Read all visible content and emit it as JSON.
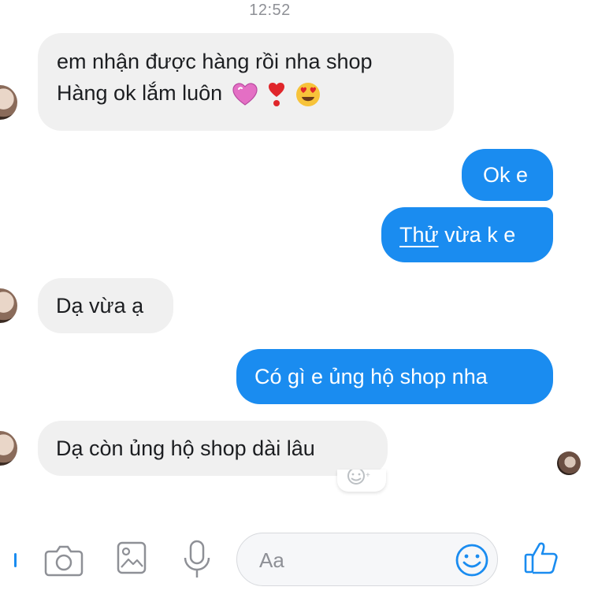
{
  "status_time": "12:52",
  "messages": [
    {
      "side": "in",
      "lines": [
        "em nhận được hàng rồi nha shop",
        "Hàng ok lắm luôn"
      ]
    },
    {
      "side": "out",
      "text": "Ok e"
    },
    {
      "side": "out",
      "text_underlined": "Thử",
      "text_rest": " vừa k e"
    },
    {
      "side": "in",
      "text": "Dạ vừa ạ"
    },
    {
      "side": "out",
      "text": "Có gì e ủng hộ shop nha"
    },
    {
      "side": "in",
      "text": "Dạ còn ủng hộ shop dài lâu"
    }
  ],
  "composer": {
    "placeholder": "Aa",
    "icons": [
      "camera-icon",
      "image-icon",
      "microphone-icon",
      "emoji-icon",
      "thumbs-up-icon"
    ]
  },
  "colors": {
    "outgoing_bubble": "#1a8cf0",
    "incoming_bubble": "#f0f0f0",
    "icon_blue": "#1a8cf0",
    "icon_gray": "#8e9096"
  }
}
